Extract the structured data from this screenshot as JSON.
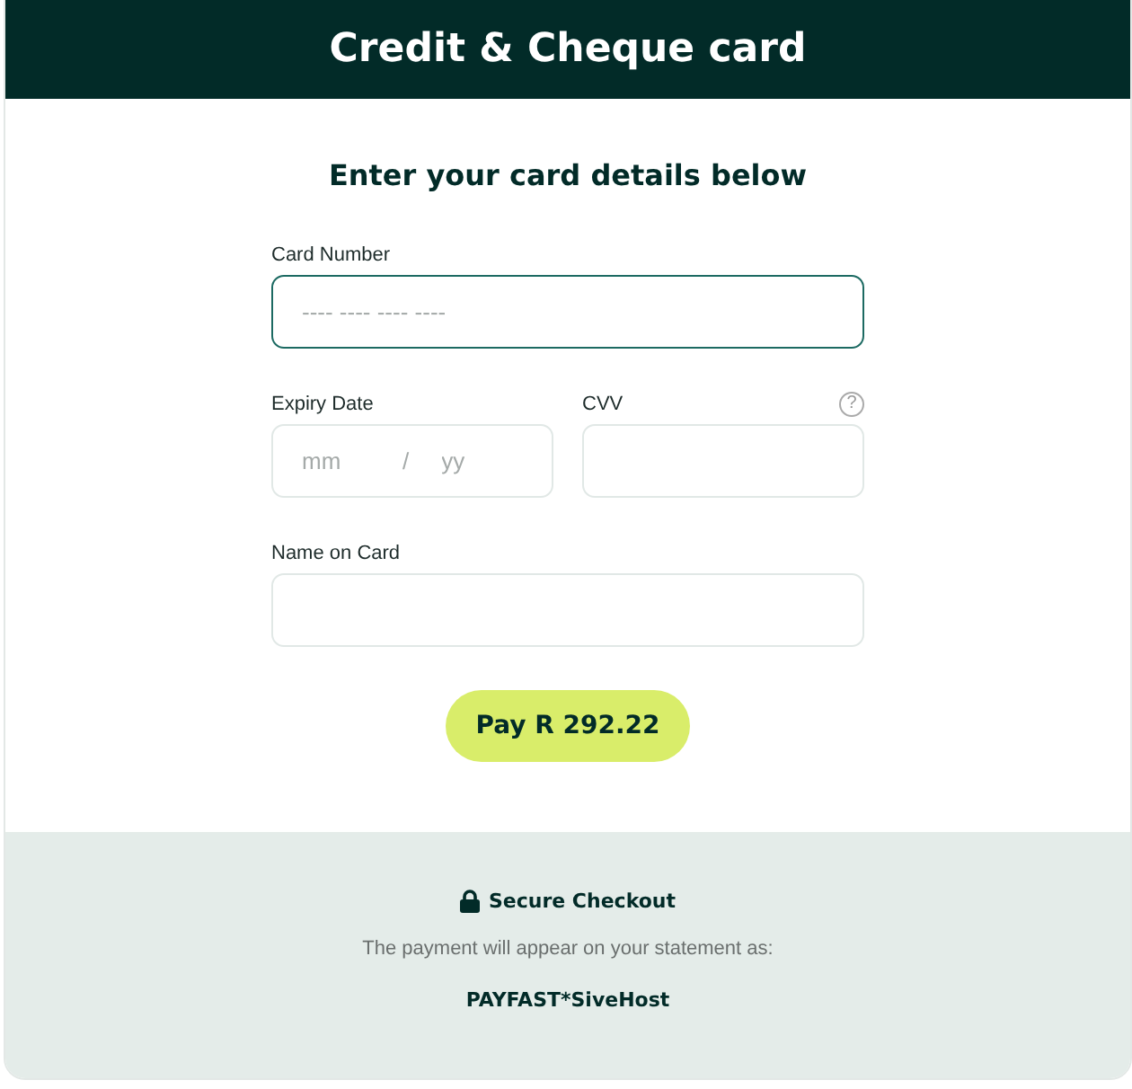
{
  "header": {
    "title": "Credit & Cheque card"
  },
  "form": {
    "heading": "Enter your card details below",
    "card_number": {
      "label": "Card Number",
      "placeholder": "---- ---- ---- ----",
      "focused": true
    },
    "expiry": {
      "label": "Expiry Date",
      "month_placeholder": "mm",
      "separator": "/",
      "year_placeholder": "yy",
      "focused": false
    },
    "cvv": {
      "label": "CVV",
      "help_icon": "?",
      "focused": false
    },
    "name": {
      "label": "Name on Card",
      "focused": false
    },
    "pay_button": "Pay R 292.22"
  },
  "footer": {
    "secure": "Secure Checkout",
    "note": "The payment will appear on your statement as:",
    "descriptor": "PAYFAST*SiveHost"
  }
}
